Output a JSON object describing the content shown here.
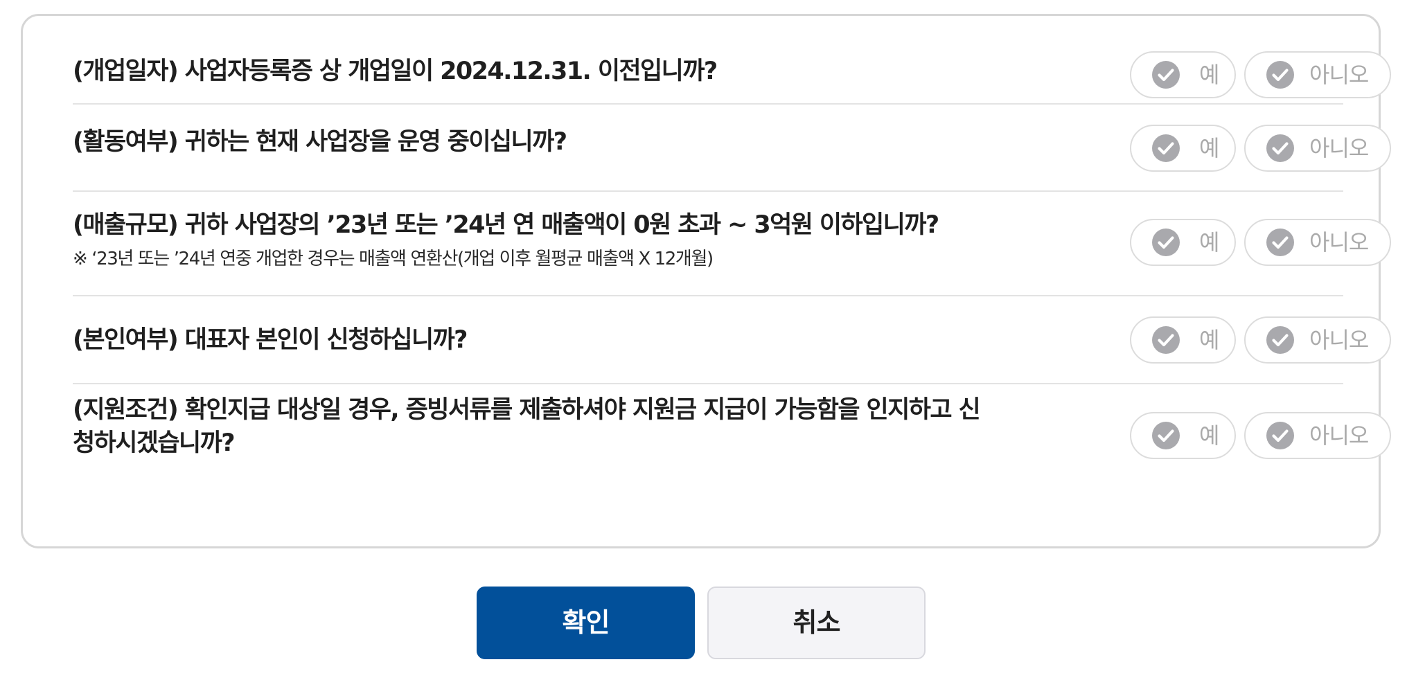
{
  "questions": [
    {
      "text": "(개업일자) 사업자등록증 상 개업일이 2024.12.31. 이전입니까?",
      "note": "",
      "yes_label": "예",
      "no_label": "아니오"
    },
    {
      "text": "(활동여부) 귀하는 현재 사업장을 운영 중이십니까?",
      "note": "",
      "yes_label": "예",
      "no_label": "아니오"
    },
    {
      "text": "(매출규모) 귀하 사업장의 ’23년 또는 ’24년 연 매출액이 0원 초과 ~ 3억원 이하입니까?",
      "note": "※ ‘23년 또는 ’24년 연중 개업한 경우는 매출액 연환산(개업 이후 월평균 매출액 X 12개월)",
      "yes_label": "예",
      "no_label": "아니오"
    },
    {
      "text": "(본인여부) 대표자 본인이 신청하십니까?",
      "note": "",
      "yes_label": "예",
      "no_label": "아니오"
    },
    {
      "text": "(지원조건) 확인지급 대상일 경우, 증빙서류를 제출하셔야 지원금 지급이 가능함을 인지하고 신청하시겠습니까?",
      "note": "",
      "yes_label": "예",
      "no_label": "아니오"
    }
  ],
  "icons": {
    "choice": "check-circle-icon"
  },
  "colors": {
    "primary": "#02509a",
    "check_icon": "#a9a9ad",
    "choice_label": "#aaaaaa"
  },
  "buttons": {
    "confirm_label": "확인",
    "cancel_label": "취소"
  }
}
